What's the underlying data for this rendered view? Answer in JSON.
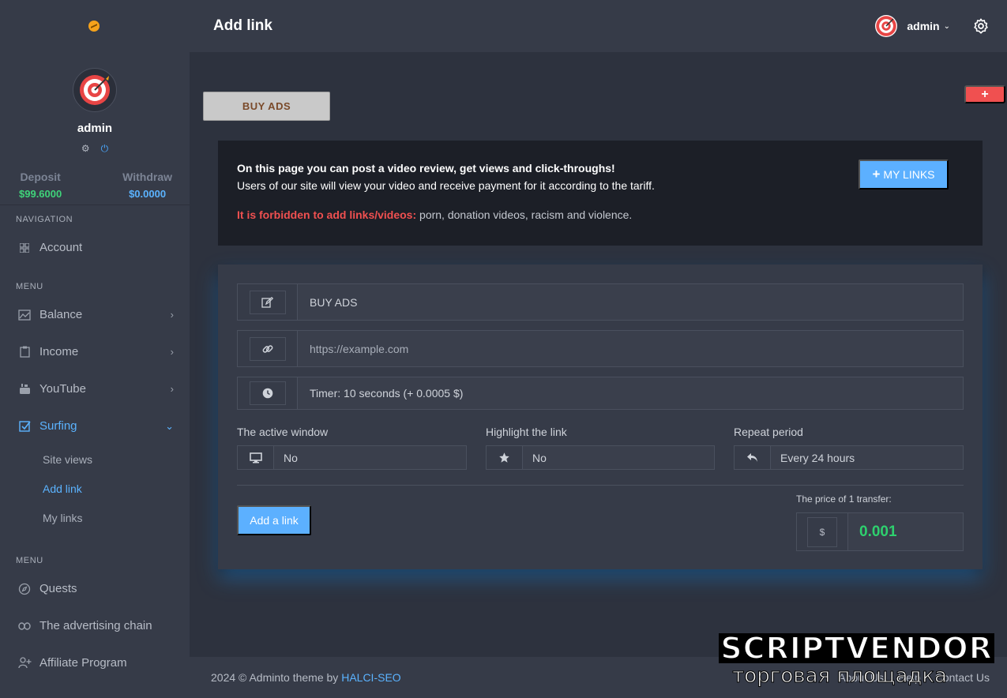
{
  "user": {
    "name": "admin"
  },
  "balances": {
    "deposit_label": "Deposit",
    "deposit_value": "$99.6000",
    "withdraw_label": "Withdraw",
    "withdraw_value": "$0.0000"
  },
  "sidebar": {
    "nav_section": "NAVIGATION",
    "account": "Account",
    "menu_section_1": "MENU",
    "balance": "Balance",
    "income": "Income",
    "youtube": "YouTube",
    "surfing": "Surfing",
    "surfing_sub": [
      "Site views",
      "Add link",
      "My links"
    ],
    "menu_section_2": "MENU",
    "quests": "Quests",
    "advertising_chain": "The advertising chain",
    "affiliate": "Affiliate Program"
  },
  "header": {
    "title": "Add link",
    "user_name": "admin"
  },
  "content": {
    "buy_ads_button": "BUY ADS",
    "plus_button": "+",
    "info": {
      "line1": "On this page you can post a video review, get views and click-throughs!",
      "line2": "Users of our site will view your video and receive payment for it according to the tariff.",
      "warning_label": "It is forbidden to add links/videos:",
      "warning_text": " porn, donation videos, racism and violence.",
      "my_links_button": "MY LINKS"
    },
    "form": {
      "title_value": "BUY ADS",
      "url_placeholder": "https://example.com",
      "timer_value": "Timer: 10 seconds (+ 0.0005 $)",
      "active_window_label": "The active window",
      "active_window_value": "No",
      "highlight_label": "Highlight the link",
      "highlight_value": "No",
      "repeat_label": "Repeat period",
      "repeat_value": "Every 24 hours",
      "add_button": "Add a link",
      "price_label": "The price of 1 transfer:",
      "price_currency": "$",
      "price_value": "0.001"
    }
  },
  "footer": {
    "text": "2024 © Adminto theme by ",
    "link": "HALCI-SEO",
    "right_links": [
      "About Us",
      "Help",
      "Contact Us"
    ]
  },
  "watermark": {
    "top": "SCRIPTVENDOR",
    "bottom": "торговая площадка"
  },
  "colors": {
    "accent": "#5cb0ff",
    "danger": "#f05050",
    "success": "#2ed06e",
    "sidebar_bg": "#363b48"
  }
}
